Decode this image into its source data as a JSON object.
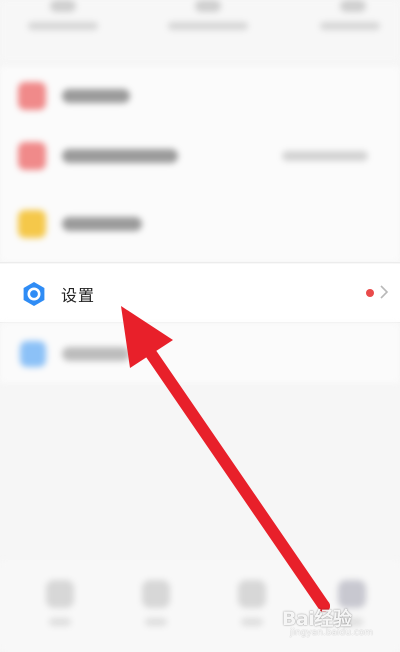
{
  "settings_item": {
    "label": "设置",
    "icon": "gear-hexagon-icon",
    "icon_color": "#2f8cf5",
    "badge_color": "#e94a4a"
  },
  "annotation": {
    "arrow_color": "#e8202a"
  },
  "watermark": {
    "brand": "Bai经验",
    "url": "jingyan.baidu.com"
  }
}
